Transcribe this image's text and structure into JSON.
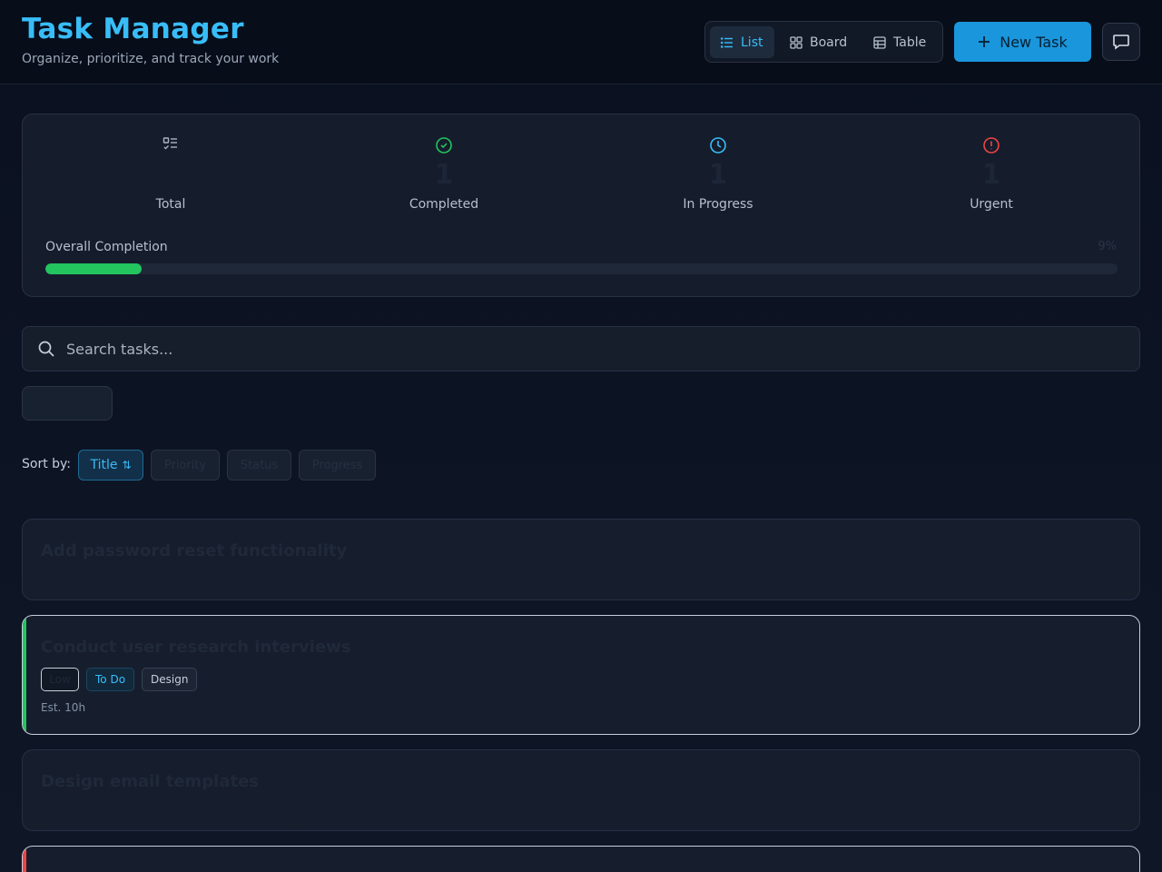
{
  "app": {
    "title": "Task Manager",
    "subtitle": "Organize, prioritize, and track your work"
  },
  "views": [
    {
      "label": "List",
      "icon": "list-icon",
      "active": true
    },
    {
      "label": "Board",
      "icon": "grid-icon",
      "active": false
    },
    {
      "label": "Table",
      "icon": "table-icon",
      "active": false
    }
  ],
  "new_task_label": "New Task",
  "stats": {
    "total": {
      "value": "",
      "label": "Total",
      "icon": "checklist-icon"
    },
    "completed": {
      "value": "1",
      "label": "Completed",
      "icon": "check-circle-icon",
      "color": "#22c55e"
    },
    "in_progress": {
      "value": "1",
      "label": "In Progress",
      "icon": "clock-icon",
      "color": "#38bdf8"
    },
    "urgent": {
      "value": "1",
      "label": "Urgent",
      "icon": "alert-circle-icon",
      "color": "#ef4444"
    }
  },
  "overall": {
    "label": "Overall Completion",
    "percent_text": "9%",
    "percent": 9
  },
  "search": {
    "placeholder": "Search tasks..."
  },
  "sort": {
    "label": "Sort by:",
    "active": "Title",
    "options": [
      "Title",
      "Priority",
      "Status",
      "Progress"
    ]
  },
  "tasks": [
    {
      "title": "Add password reset functionality"
    },
    {
      "title": "Conduct user research interviews",
      "priority": "Low",
      "status": "To Do",
      "category": "Design",
      "estimate": "Est. 10h",
      "accent": "#22c55e"
    },
    {
      "title": "Design email templates"
    },
    {
      "title": "",
      "accent": "#ef4444"
    }
  ]
}
